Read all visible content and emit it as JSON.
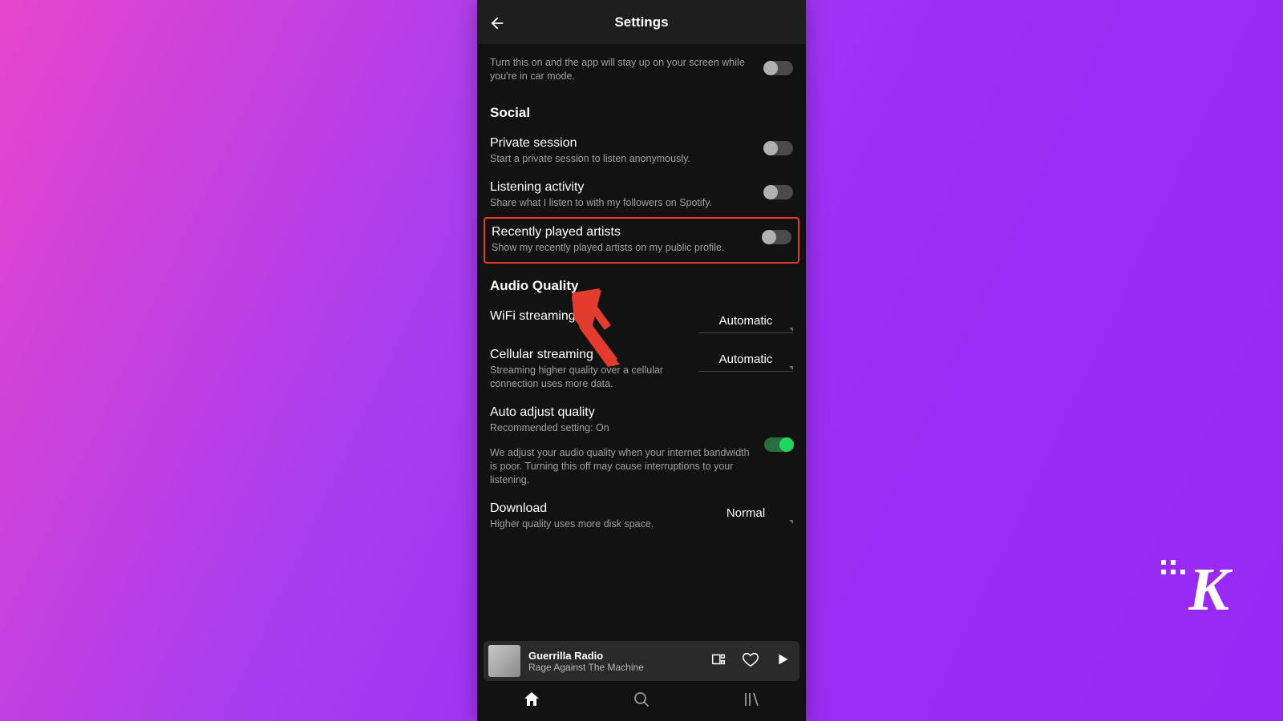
{
  "header": {
    "title": "Settings"
  },
  "top_partial": {
    "sub": "Turn this on and the app will stay up on your screen while you're in car mode."
  },
  "sections": {
    "social": {
      "header": "Social",
      "private_session": {
        "title": "Private session",
        "sub": "Start a private session to listen anonymously."
      },
      "listening_activity": {
        "title": "Listening activity",
        "sub": "Share what I listen to with my followers on Spotify."
      },
      "recently_played": {
        "title": "Recently played artists",
        "sub": "Show my recently played artists on my public profile."
      }
    },
    "audio": {
      "header": "Audio Quality",
      "wifi": {
        "title": "WiFi streaming",
        "value": "Automatic"
      },
      "cellular": {
        "title": "Cellular streaming",
        "sub": "Streaming higher quality over a cellular connection uses more data.",
        "value": "Automatic"
      },
      "auto_adjust": {
        "title": "Auto adjust quality",
        "sub": "Recommended setting: On",
        "desc": "We adjust your audio quality when your internet bandwidth is poor. Turning this off may cause interruptions to your listening."
      },
      "download": {
        "title": "Download",
        "sub": "Higher quality uses more disk space.",
        "value": "Normal"
      }
    }
  },
  "now_playing": {
    "title": "Guerrilla Radio",
    "artist": "Rage Against The Machine"
  },
  "watermark": "K"
}
